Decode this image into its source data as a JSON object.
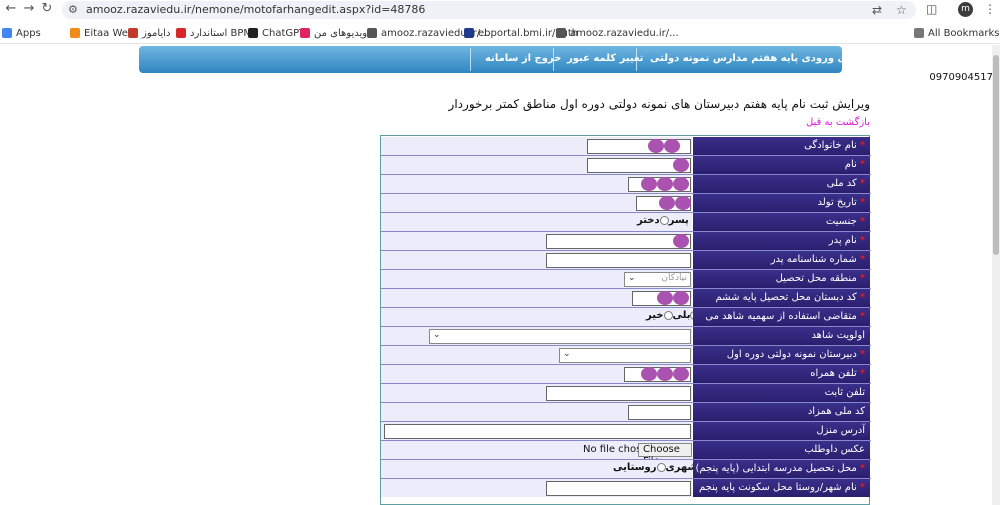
{
  "browser": {
    "url": "amooz.razaviedu.ir/nemone/motofarhangedit.aspx?id=48786",
    "avatar_letter": "m",
    "all_bookmarks": "All Bookmarks"
  },
  "bookmarks": [
    {
      "label": "Apps",
      "color": "#4285f4"
    },
    {
      "label": "Eitaa Web",
      "color": "#f28a1a"
    },
    {
      "label": "دایاموز",
      "color": "#c0392b"
    },
    {
      "label": "استاندارد BPMS",
      "color": "#d62828"
    },
    {
      "label": "ChatGPT",
      "color": "#222222"
    },
    {
      "label": "ویدیوهای من",
      "color": "#e0245e"
    },
    {
      "label": "amooz.razaviedu.ir/...",
      "color": "#555555"
    },
    {
      "label": "ebportal.bmi.ir/auth",
      "color": "#1f3a8a"
    },
    {
      "label": "amooz.razaviedu.ir/...",
      "color": "#555555"
    }
  ],
  "menu": {
    "items": [
      "فرم امتیازبندی ورودی پایه هفتم مدارس نمونه دولتی",
      "تغییر کلمه عبور",
      "خروج از سامانه"
    ]
  },
  "header": {
    "phone": "0970904517",
    "title": "ویرایش ثبت نام پایه هفتم دبیرستان های نمونه دولتی دوره اول مناطق کمتر برخوردار",
    "back_link": "بازگشت به قبل"
  },
  "form": {
    "rows": [
      {
        "label": "نام خانوادگی",
        "required": true
      },
      {
        "label": "نام",
        "required": true
      },
      {
        "label": "کد ملی",
        "required": true
      },
      {
        "label": "تاریخ تولد",
        "required": true
      },
      {
        "label": "جنسیت",
        "required": true
      },
      {
        "label": "نام پدر",
        "required": true
      },
      {
        "label": "شماره شناسنامه پدر",
        "required": true
      },
      {
        "label": "منطقه محل تحصیل",
        "required": true
      },
      {
        "label": "کد دبستان محل تحصیل پایه ششم",
        "required": true
      },
      {
        "label": "متقاضی استفاده از سهمیه شاهد می باشم؟",
        "required": true
      },
      {
        "label": "اولویت شاهد",
        "required": false
      },
      {
        "label": "دبیرستان نمونه دولتی دوره اول متوسطه",
        "required": true
      },
      {
        "label": "تلفن همراه",
        "required": true
      },
      {
        "label": "تلفن ثابت",
        "required": false
      },
      {
        "label": "کد ملی همزاد",
        "required": false
      },
      {
        "label": "آدرس منزل",
        "required": false
      },
      {
        "label": "عکس داوطلب",
        "required": false
      },
      {
        "label": "محل تحصیل مدرسه ابتدایی (پایه پنجم)",
        "required": true
      },
      {
        "label": "نام شهر/روستا محل سکونت پایه پنجم",
        "required": true
      }
    ],
    "gender": {
      "male": "پسر",
      "female": "دختر"
    },
    "shahed": {
      "yes": "بلی",
      "no": "خیر"
    },
    "region_value": "نیادکان",
    "file": {
      "button": "Choose File",
      "status": "No file chosen"
    },
    "school_location": {
      "city": "شهری",
      "village": "روستایی"
    }
  },
  "colors": {
    "menu": "#2f86c2",
    "label_bg": "#2a1f6e",
    "value_bg": "#ececfa",
    "required": "#ff2020",
    "back_link": "#e012e0",
    "redaction": "#a952b0"
  }
}
